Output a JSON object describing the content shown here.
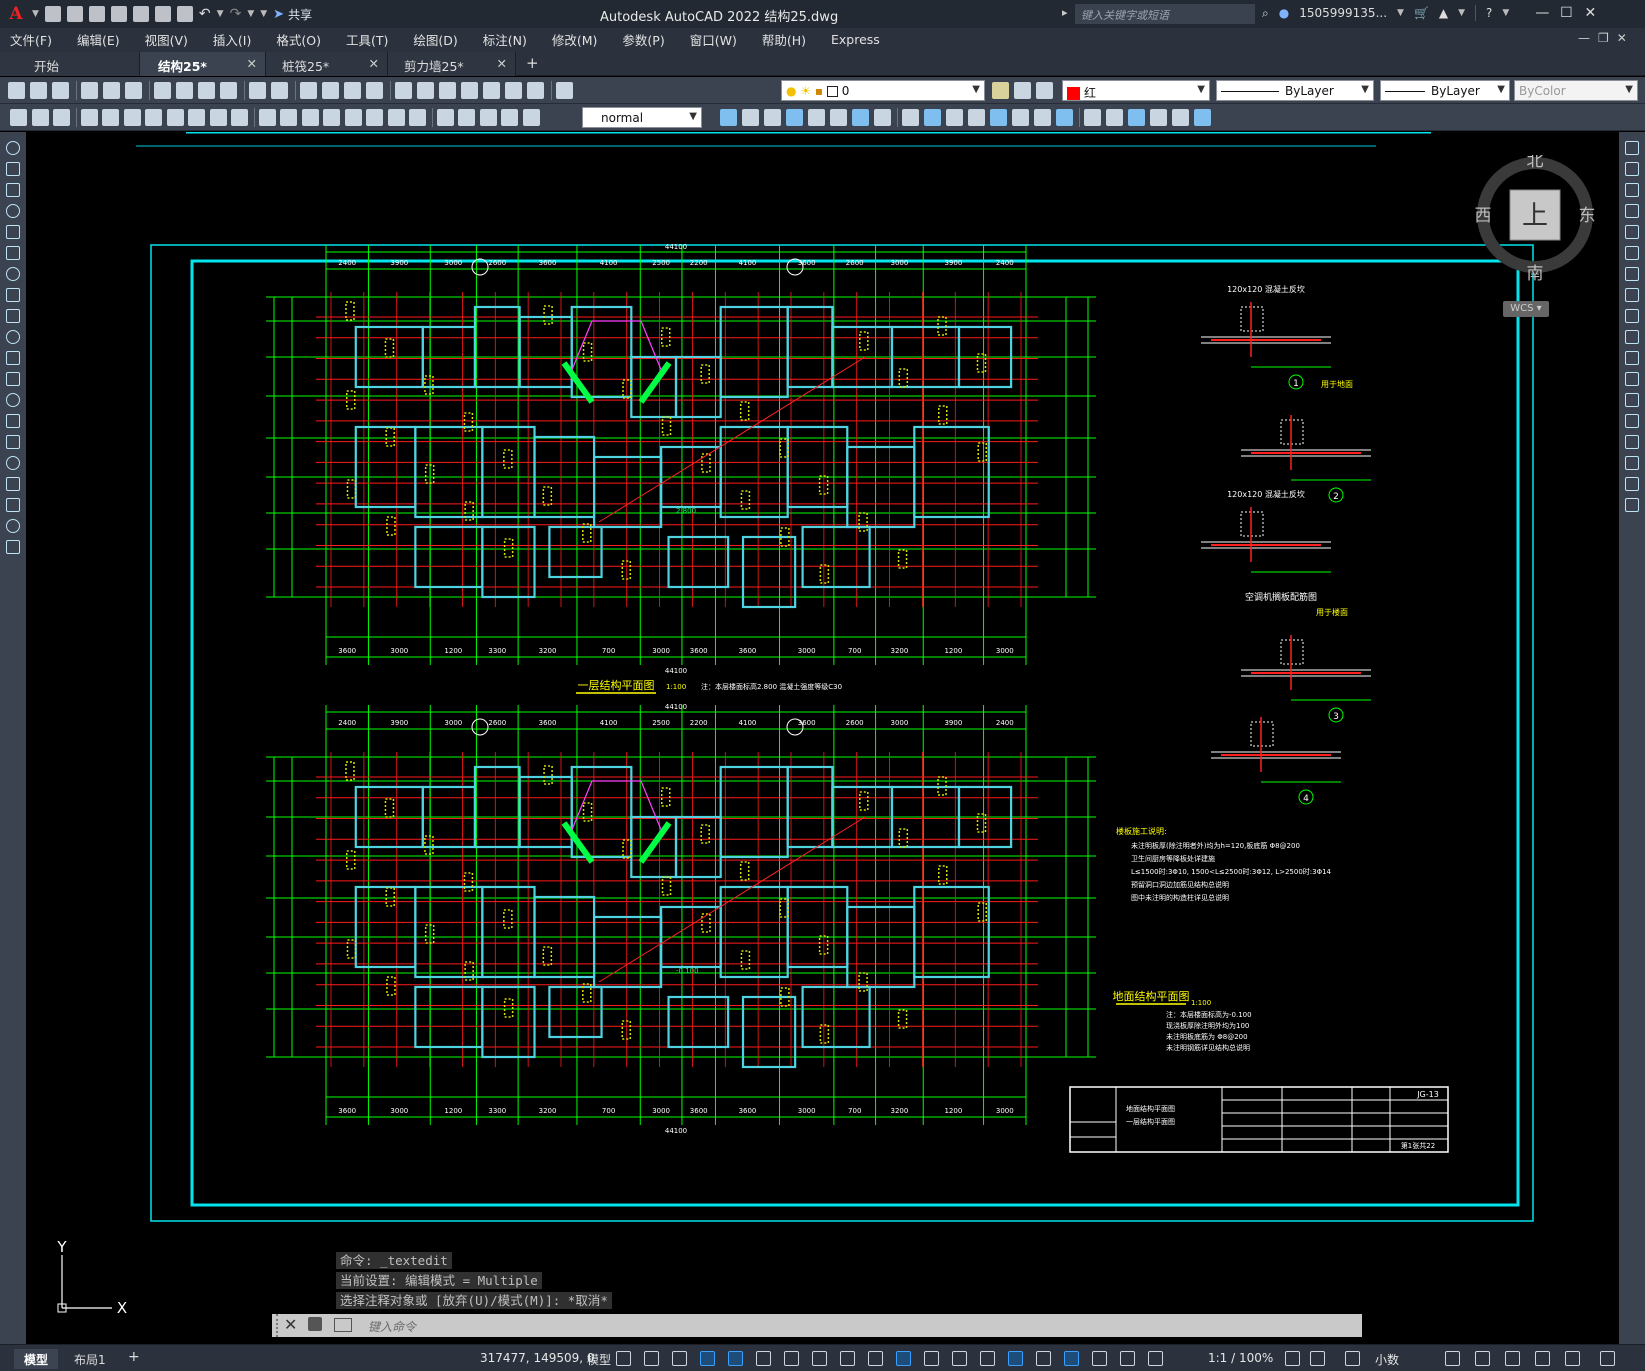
{
  "title_bar": {
    "app_logo": "A",
    "share_label": "共享",
    "window_title": "Autodesk AutoCAD 2022    结构25.dwg",
    "search_placeholder": "键入关键字或短语",
    "user_name": "1505999135...",
    "icons": [
      "new-icon",
      "open-icon",
      "save-icon",
      "saveas-icon",
      "publish-icon",
      "plot-icon",
      "undo-icon",
      "redo-icon",
      "share-icon",
      "search-icon",
      "user-icon",
      "cart-icon",
      "autodesk-icon",
      "help-icon",
      "minimize-icon",
      "maximize-icon",
      "close-icon"
    ]
  },
  "menu": {
    "items": [
      "文件(F)",
      "编辑(E)",
      "视图(V)",
      "插入(I)",
      "格式(O)",
      "工具(T)",
      "绘图(D)",
      "标注(N)",
      "修改(M)",
      "参数(P)",
      "窗口(W)",
      "帮助(H)",
      "Express"
    ]
  },
  "tabs": [
    {
      "label": "开始"
    },
    {
      "label": "结构25*"
    },
    {
      "label": "桩筏25*"
    },
    {
      "label": "剪力墙25*"
    }
  ],
  "tab_add": "+",
  "toolbar": {
    "layer_value": "0",
    "color_value": "红",
    "color_hex": "#ff0000",
    "linetype_value": "ByLayer",
    "lineweight_value": "ByLayer",
    "plotstyle_value": "ByColor",
    "text_style_value": "normal"
  },
  "viewcube": {
    "north": "北",
    "south": "南",
    "east": "东",
    "west": "西",
    "face": "上",
    "wcs": "WCS"
  },
  "drawing": {
    "plan1_title": "一层结构平面图",
    "plan1_scale": "1:100",
    "plan2_title": "地面结构平面图",
    "plan2_scale": "1:100",
    "plan1_note": "注：本层楼面标高2.800  混凝土强度等级C30",
    "detail_titles": [
      "120x120 混凝土反坎",
      "用于地面",
      "120x120 混凝土反坎",
      "空调机搁板配筋图",
      "用于楼面"
    ],
    "detail_numbers": [
      "1",
      "2",
      "3",
      "4"
    ],
    "notes_title": "楼板施工说明:",
    "notes_lines": [
      "未注明板厚(除注明者外)均为h=120,板底筋 Φ8@200",
      "卫生间厨房等降板处详建施",
      "L≤1500时:3Φ10, 1500<L≤2500时:3Φ12, L>2500时:3Φ14",
      "预留洞口洞边加筋见结构总说明",
      "图中未注明的构造柱详见总说明"
    ],
    "ground_note_lines": [
      "注：本层楼面标高为-0.100",
      "现浇板厚除注明外均为100",
      "未注明板底筋为 Φ8@200",
      "未注明钢筋详见结构总说明"
    ],
    "title_block": {
      "drawing_name_1": "地面结构平面图",
      "drawing_name_2": "一层结构平面图",
      "sheet_no": "JG-13",
      "sheet_of": "第1张共22"
    },
    "dimensions_top": [
      "2400",
      "3900",
      "3000",
      "2600",
      "3600",
      "4100",
      "2500",
      "2200",
      "4100",
      "3600",
      "2600",
      "3000",
      "3900",
      "2400"
    ],
    "dimensions_bottom": [
      "3600",
      "3000",
      "1200",
      "3300",
      "3200",
      "700",
      "3000",
      "3600",
      "3600",
      "3000",
      "700",
      "3200",
      "1200",
      "3000",
      "3600"
    ],
    "total_dim": "44100",
    "elevation_labels": [
      "2.800",
      "-0.100"
    ]
  },
  "command": {
    "history": [
      "命令: _textedit",
      "当前设置: 编辑模式 = Multiple",
      "选择注释对象或 [放弃(U)/模式(M)]: *取消*"
    ],
    "placeholder": "键入命令"
  },
  "ucs": {
    "y": "Y",
    "x": "X"
  },
  "status": {
    "layout_tabs": [
      "模型",
      "布局1"
    ],
    "add_layout": "+",
    "coordinates": "317477, 149509, 0",
    "mode": "模型",
    "scale": "1:1 / 100%",
    "units": "小数"
  }
}
